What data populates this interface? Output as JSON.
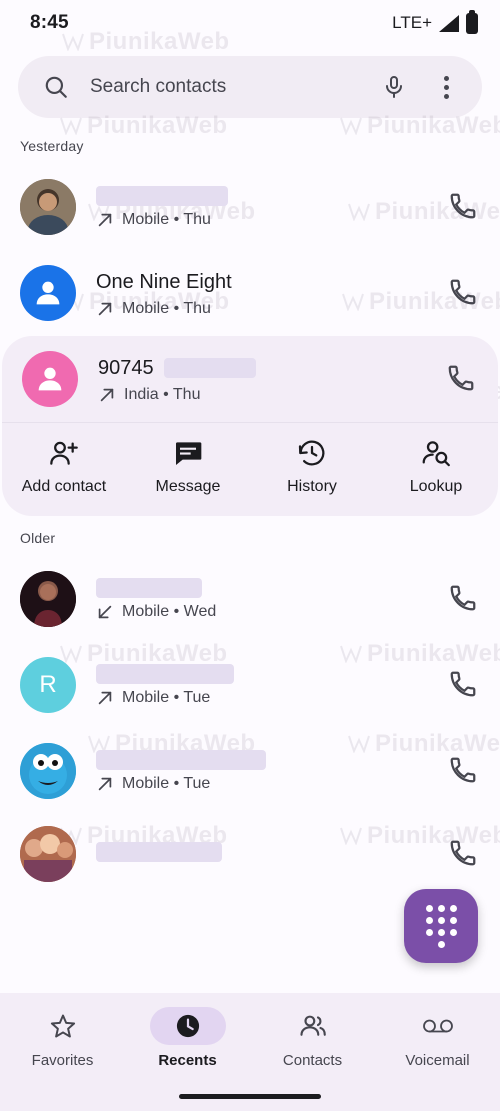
{
  "status_bar": {
    "time": "8:45",
    "network": "LTE+",
    "signal_icon": "signal-bars-icon",
    "battery_icon": "battery-full-icon"
  },
  "search": {
    "placeholder": "Search contacts",
    "search_icon": "search-icon",
    "mic_icon": "microphone-icon",
    "overflow_icon": "more-options-icon"
  },
  "sections": [
    {
      "label": "Yesterday"
    },
    {
      "label": "Older"
    }
  ],
  "calls": [
    {
      "name": "",
      "name_redacted": true,
      "redact_width": 132,
      "subtitle": "Mobile • Thu",
      "direction": "outgoing",
      "avatar_type": "photo-man",
      "avatar_color": "#7a6a5a",
      "selected": false
    },
    {
      "name": "One Nine Eight",
      "name_redacted": false,
      "redact_width": 0,
      "subtitle": "Mobile • Thu",
      "direction": "outgoing",
      "avatar_type": "person-icon",
      "avatar_color": "#1a73e8",
      "selected": false
    },
    {
      "name": "90745",
      "name_redacted": true,
      "redact_width": 92,
      "subtitle": "India • Thu",
      "direction": "outgoing",
      "avatar_type": "person-icon",
      "avatar_color": "#f06ab0",
      "selected": true
    },
    {
      "name": "",
      "name_redacted": true,
      "redact_width": 106,
      "subtitle": "Mobile • Wed",
      "direction": "incoming",
      "avatar_type": "photo-dark",
      "avatar_color": "#2a1418",
      "selected": false
    },
    {
      "name": "",
      "name_redacted": true,
      "redact_width": 138,
      "subtitle": "Mobile • Tue",
      "direction": "outgoing",
      "avatar_type": "letter",
      "avatar_letter": "R",
      "avatar_color": "#5ecfde",
      "selected": false
    },
    {
      "name": "",
      "name_redacted": true,
      "redact_width": 170,
      "subtitle": "Mobile • Tue",
      "direction": "outgoing",
      "avatar_type": "photo-blue",
      "avatar_color": "#3ab7e8",
      "selected": false
    },
    {
      "name": "",
      "name_redacted": true,
      "redact_width": 126,
      "subtitle": "",
      "direction": "none",
      "avatar_type": "photo-group",
      "avatar_color": "#a15f4a",
      "selected": false
    }
  ],
  "expanded_actions": [
    {
      "label": "Add contact",
      "icon": "person-add-icon"
    },
    {
      "label": "Message",
      "icon": "message-icon"
    },
    {
      "label": "History",
      "icon": "history-icon"
    },
    {
      "label": "Lookup",
      "icon": "person-search-icon"
    }
  ],
  "fab": {
    "icon": "dialpad-icon",
    "color": "#7b4fa8"
  },
  "bottom_nav": [
    {
      "label": "Favorites",
      "icon": "star-icon",
      "active": false
    },
    {
      "label": "Recents",
      "icon": "clock-icon",
      "active": true
    },
    {
      "label": "Contacts",
      "icon": "people-icon",
      "active": false
    },
    {
      "label": "Voicemail",
      "icon": "voicemail-icon",
      "active": false
    }
  ],
  "watermark": {
    "text": "PiunikaWeb"
  },
  "colors": {
    "accent": "#7b4fa8",
    "surface": "#fdfbff",
    "surface_variant": "#f1ecf4",
    "selected_row": "#f3edf7",
    "on_surface": "#1b1b1f",
    "on_surface_variant": "#46464f"
  }
}
